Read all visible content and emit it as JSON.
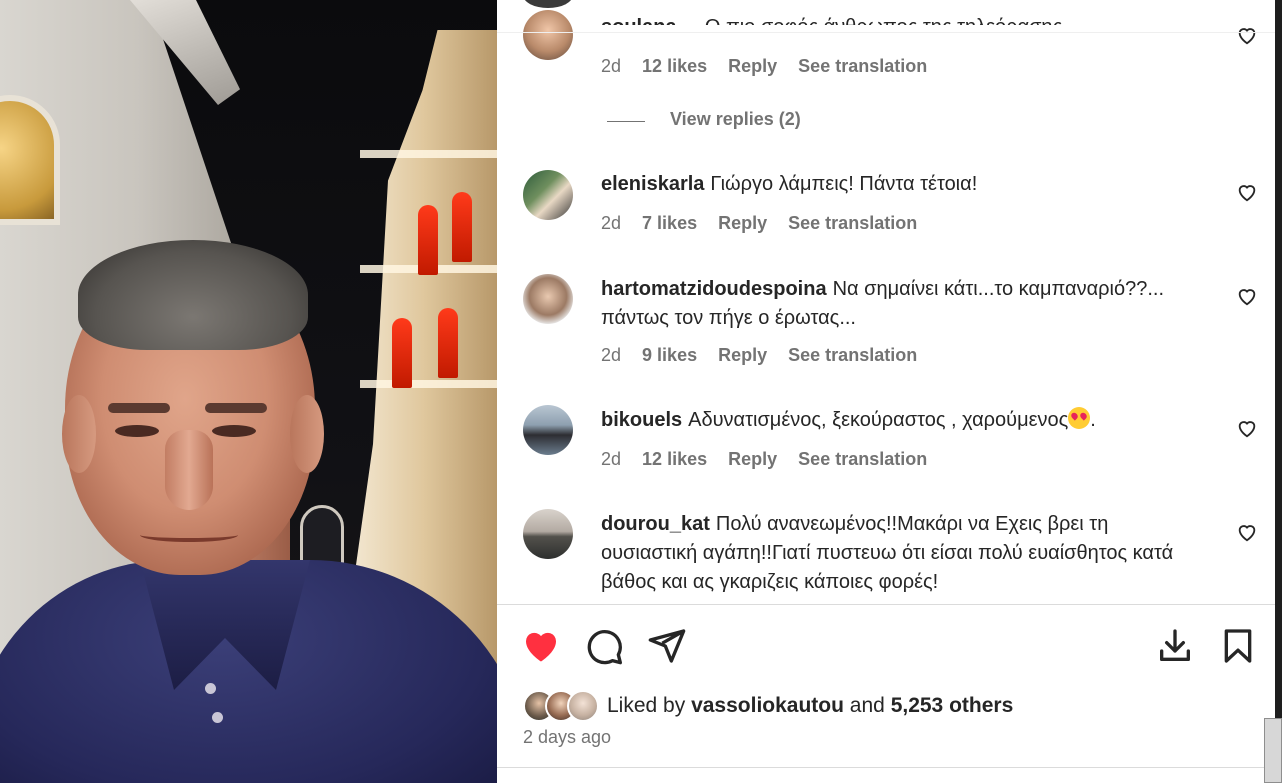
{
  "post": {
    "liked_by_prefix": "Liked by",
    "liked_by_user": "vassoliokautou",
    "liked_by_and": "and",
    "liked_by_others": "5,253 others",
    "posted_ago": "2 days ago"
  },
  "comments": [
    {
      "username": "soulana__",
      "text": "Ο πιο σοφός άνθρωπος της τηλεόρασης",
      "age": "2d",
      "likes": "12 likes",
      "reply": "Reply",
      "translate": "See translation",
      "view_replies": "View replies (2)"
    },
    {
      "username": "eleniskarla",
      "text": "Γιώργο λάμπεις! Πάντα τέτοια!",
      "age": "2d",
      "likes": "7 likes",
      "reply": "Reply",
      "translate": "See translation"
    },
    {
      "username": "hartomatzidoudespoina",
      "text": "Να σημαίνει κάτι...το καμπαναριό??... πάντως τον πήγε ο έρωτας...",
      "age": "2d",
      "likes": "9 likes",
      "reply": "Reply",
      "translate": "See translation"
    },
    {
      "username": "bikouels",
      "text": "Αδυνατισμένος, ξεκούραστος , χαρούμενος",
      "text_suffix": ".",
      "emoji": "heart-eyes-emoji",
      "age": "2d",
      "likes": "12 likes",
      "reply": "Reply",
      "translate": "See translation"
    },
    {
      "username": "dourou_kat",
      "text": "Πολύ ανανεωμένος!!Μακάρι να Εχεις βρει τη ουσιαστική αγάπη!!Γιατί πυστευω ότι είσαι πολύ ευαίσθητος κατά βάθος και ας γκαριζεις κάποιες φορές!"
    }
  ],
  "icons": {
    "like": "heart-filled-icon",
    "comment": "comment-bubble-icon",
    "share": "paper-plane-icon",
    "download": "download-icon",
    "save": "bookmark-icon",
    "comment_like": "heart-outline-icon"
  },
  "colors": {
    "like_red": "#ff3040",
    "text": "#262626",
    "secondary": "#737373"
  }
}
